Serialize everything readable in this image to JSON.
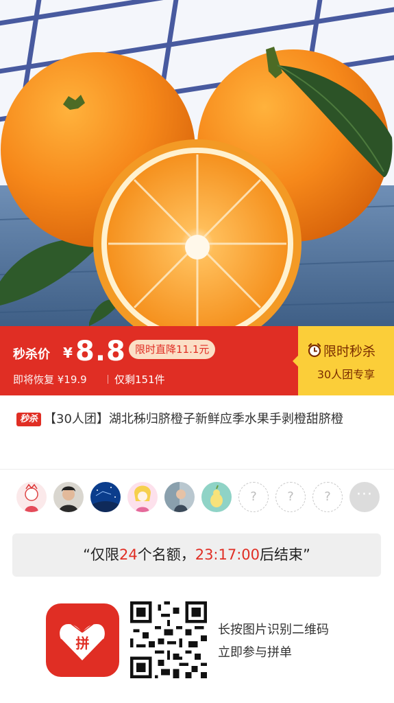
{
  "product": {
    "image_alt": "navel oranges on a table"
  },
  "price_banner": {
    "flash_label": "秒杀价",
    "currency": "¥",
    "price": "8.8",
    "drop_badge": "限时直降11.1元",
    "restore_text": "即将恢复 ¥19.9",
    "remaining_text": "仅剩151件",
    "limited_label": "限时秒杀",
    "group_label": "30人团专享",
    "colors": {
      "red": "#e02e24",
      "yellow": "#fbce39"
    }
  },
  "title": {
    "tag": "秒杀",
    "text": "【30人团】湖北秭归脐橙子新鲜应季水果手剥橙甜脐橙"
  },
  "group": {
    "joined_avatars": [
      "avatar-1",
      "avatar-2",
      "avatar-3",
      "avatar-4",
      "avatar-5",
      "avatar-6"
    ],
    "empty_slot_label": "?",
    "more_label": "···"
  },
  "quota": {
    "prefix": "“仅限",
    "count": "24",
    "middle": "个名额，",
    "time": "23:17:00",
    "suffix": "后结束”"
  },
  "footer": {
    "hint_line1": "长按图片识别二维码",
    "hint_line2": "立即参与拼单",
    "logo_text": "拼"
  }
}
